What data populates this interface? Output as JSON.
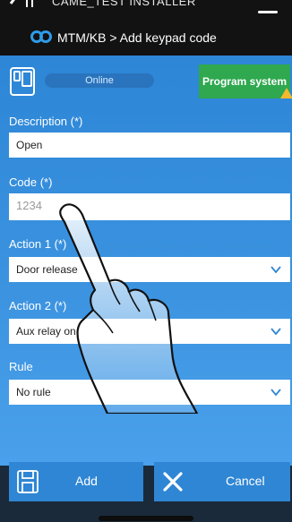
{
  "header": {
    "title": "CAME_TEST INSTALLER",
    "breadcrumb": "MTM/KB > Add keypad code"
  },
  "status": {
    "connection": "Online",
    "program_button": "Program system"
  },
  "form": {
    "description": {
      "label": "Description (*)",
      "value": "Open"
    },
    "code": {
      "label": "Code (*)",
      "placeholder": "1234"
    },
    "action1": {
      "label": "Action 1 (*)",
      "selected": "Door release"
    },
    "action2": {
      "label": "Action 2 (*)",
      "selected": "Aux relay on"
    },
    "rule": {
      "label": "Rule",
      "selected": "No rule"
    }
  },
  "footer": {
    "add_label": "Add",
    "cancel_label": "Cancel"
  },
  "colors": {
    "accent": "#2f86d4",
    "program_green": "#2fa84f",
    "warning": "#f5b82e"
  }
}
